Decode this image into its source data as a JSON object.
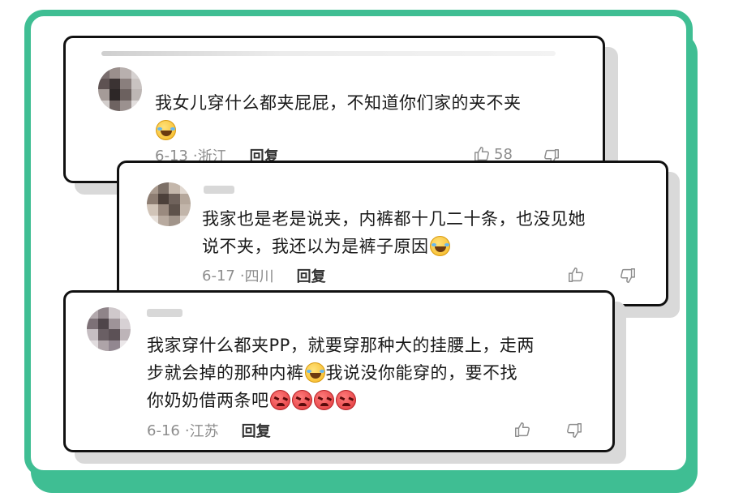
{
  "accent_color": "#3fbe93",
  "comments": [
    {
      "text": "我女儿穿什么都夹屁屁，不知道你们家的夹不夹",
      "emojis": [
        "laughing-crying"
      ],
      "date": "6-13",
      "location": "浙江",
      "reply": "回复",
      "likes": "58"
    },
    {
      "text_line1": "我家也是老是说夹，内裤都十几二十条，也没见她",
      "text_line2": "说不夹，我还以为是裤子原因",
      "emojis": [
        "laughing-crying"
      ],
      "date": "6-17",
      "location": "四川",
      "reply": "回复",
      "likes": ""
    },
    {
      "text_line1": "我家穿什么都夹PP，就要穿那种大的挂腰上，走两",
      "text_line2a": "步就会掉的那种内裤",
      "text_line2b": "我说没你能穿的，要不找",
      "text_line3": "你奶奶借两条吧",
      "emojis": [
        "laughing-crying",
        "angry",
        "angry",
        "angry",
        "angry"
      ],
      "date": "6-16",
      "location": "江苏",
      "reply": "回复",
      "likes": ""
    }
  ]
}
